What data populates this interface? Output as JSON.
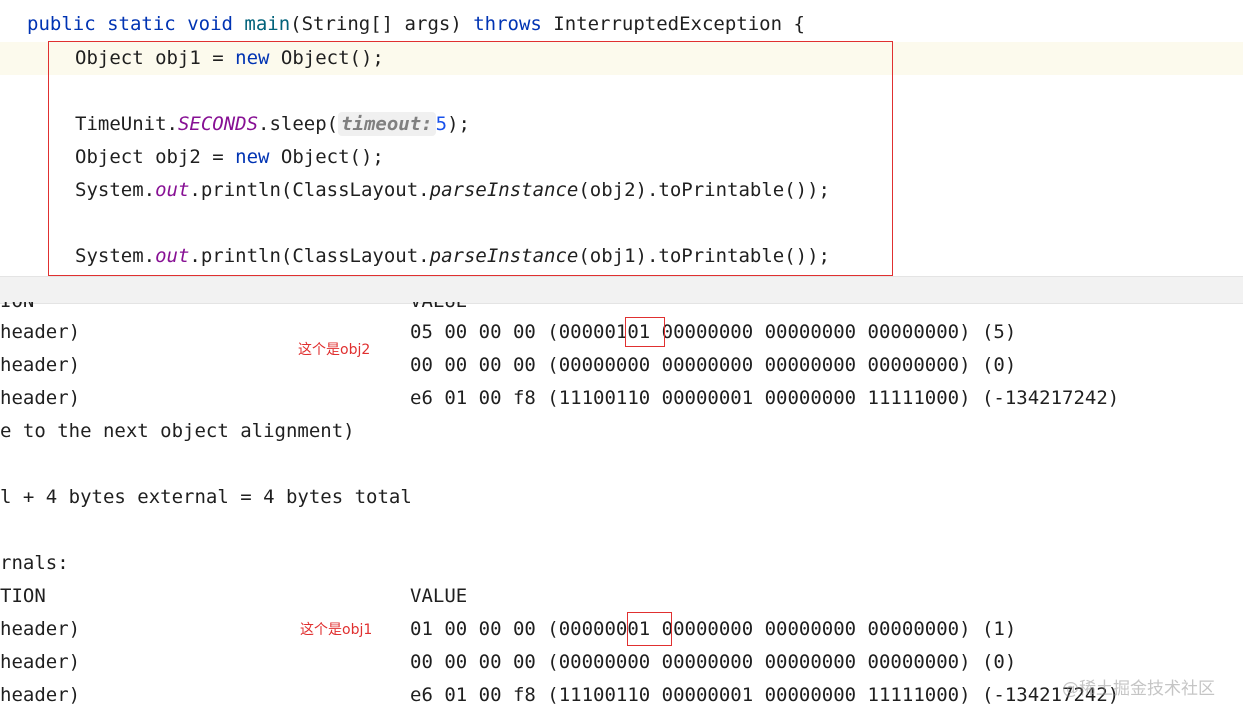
{
  "editor": {
    "line_main": {
      "kw1": "public",
      "kw2": "static",
      "kw3": "void",
      "method": "main",
      "params": "(String[] args) ",
      "kw4": "throws",
      "rest": " InterruptedException {"
    },
    "line_obj1": {
      "pre": "Object obj1 = ",
      "kw": "new",
      "post": " Object();"
    },
    "line_sleep": {
      "pre": "TimeUnit.",
      "field": "SECONDS",
      "mid": ".sleep(",
      "hint": "timeout:",
      "num": "5",
      "post": ");"
    },
    "line_obj2": {
      "pre": "Object obj2 = ",
      "kw": "new",
      "post": " Object();"
    },
    "line_print2": {
      "pre": "System.",
      "field": "out",
      "mid": ".println(ClassLayout.",
      "call": "parseInstance",
      "post": "(obj2).toPrintable());"
    },
    "line_print1": {
      "pre": "System.",
      "field": "out",
      "mid": ".println(ClassLayout.",
      "call": "parseInstance",
      "post": "(obj1).toPrintable());"
    }
  },
  "output": {
    "block1": {
      "header_left": "ION",
      "header_right": "VALUE",
      "rows": [
        {
          "left": "header)",
          "value": "05 00 00 00 (00000101 00000000 00000000 00000000) (5)"
        },
        {
          "left": "header)",
          "value": "00 00 00 00 (00000000 00000000 00000000 00000000) (0)"
        },
        {
          "left": "header)",
          "value": "e6 01 00 f8 (11100110 00000001 00000000 11111000) (-134217242)"
        }
      ],
      "alignment": "e to the next object alignment)",
      "summary": "l + 4 bytes external = 4 bytes total",
      "note": "这个是obj2"
    },
    "block2": {
      "section": "rnals:",
      "header_left": "TION",
      "header_right": "VALUE",
      "rows": [
        {
          "left": "header)",
          "value": "01 00 00 00 (00000001 00000000 00000000 00000000) (1)"
        },
        {
          "left": "header)",
          "value": "00 00 00 00 (00000000 00000000 00000000 00000000) (0)"
        },
        {
          "left": "header)",
          "value": "e6 01 00 f8 (11100110 00000001 00000000 11111000) (-134217242)"
        }
      ],
      "note": "这个是obj1"
    }
  },
  "watermark": "@稀土掘金技术社区",
  "colors": {
    "keyword": "#0033b3",
    "static_field": "#871094",
    "number": "#1750eb",
    "annotation_red": "#e03030",
    "current_line": "#fcfaed"
  }
}
